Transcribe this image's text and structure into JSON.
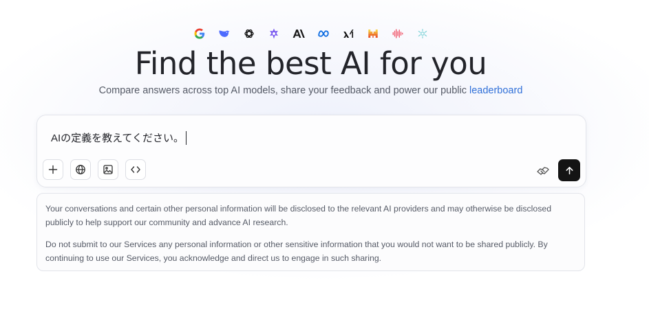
{
  "model_logos": [
    {
      "icon": "google-logo-icon",
      "color": "#4285F4"
    },
    {
      "icon": "deepseek-logo-icon",
      "color": "#4D6BFE"
    },
    {
      "icon": "openai-logo-icon",
      "color": "#111111"
    },
    {
      "icon": "gemini-style-logo-icon",
      "color": "#7b5cf0"
    },
    {
      "icon": "anthropic-logo-icon",
      "color": "#191919"
    },
    {
      "icon": "meta-logo-icon",
      "color": "#0668E1"
    },
    {
      "icon": "xai-logo-icon",
      "color": "#111111"
    },
    {
      "icon": "mistral-logo-icon",
      "color": "#F7D046"
    },
    {
      "icon": "waveform-logo-icon",
      "color": "#F0566A"
    },
    {
      "icon": "cohere-style-logo-icon",
      "color": "#7fd3d8"
    }
  ],
  "hero": {
    "title": "Find the best AI for you",
    "subtitle": "Compare answers across top AI models, share your feedback and power our public ",
    "subtitle_link": "leaderboard"
  },
  "composer": {
    "input_value": "AIの定義を教えてください。",
    "tools": [
      {
        "icon": "plus-icon"
      },
      {
        "icon": "globe-icon"
      },
      {
        "icon": "image-icon"
      },
      {
        "icon": "code-icon"
      }
    ],
    "feedback_icon": "handshake-icon",
    "send_icon": "arrow-up-icon",
    "send_bg": "#141414"
  },
  "disclaimer": {
    "paragraph_1": "Your conversations and certain other personal information will be disclosed to the relevant AI providers and may otherwise be disclosed publicly to help support our community and advance AI research.",
    "paragraph_2": "Do not submit to our Services any personal information or other sensitive information that you would not want to be shared publicly. By continuing to use our Services, you acknowledge and direct us to engage in such sharing."
  }
}
